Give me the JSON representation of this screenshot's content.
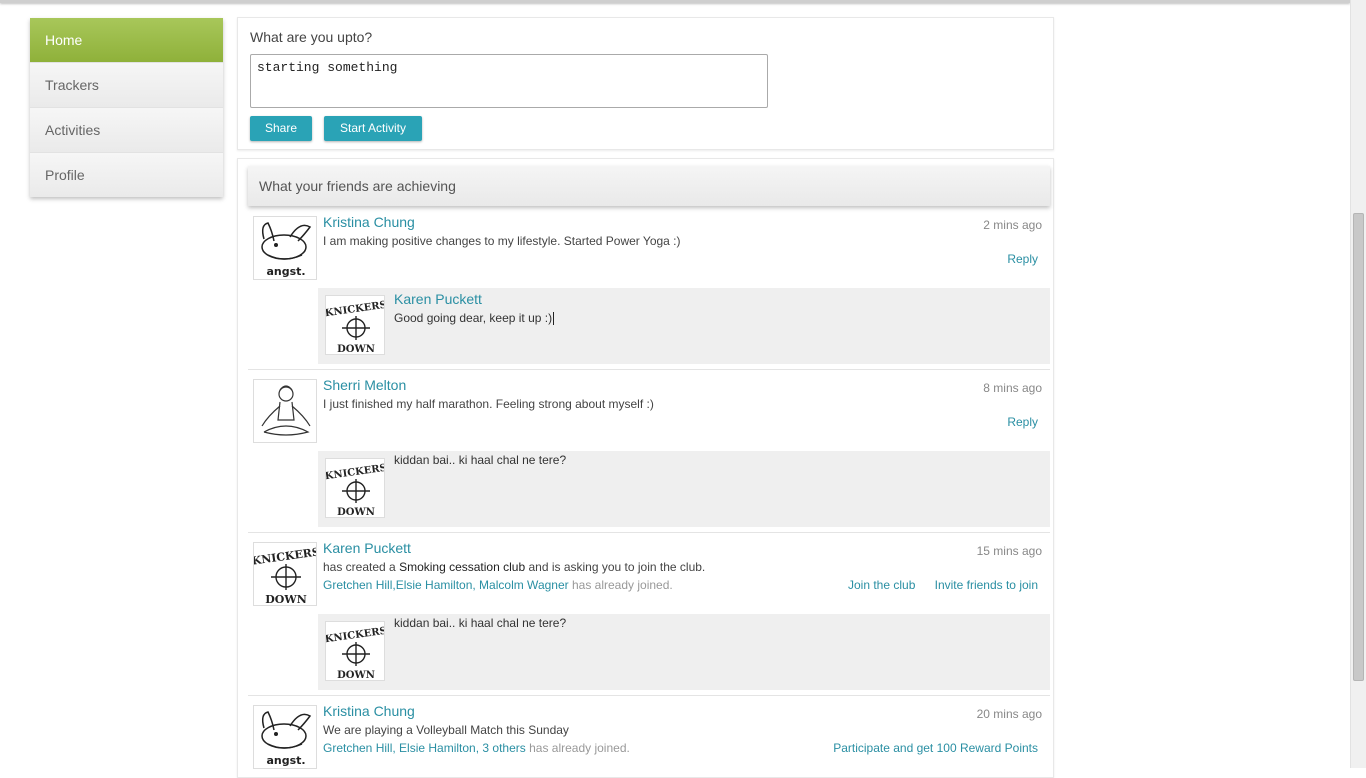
{
  "sidebar": {
    "items": [
      {
        "label": "Home",
        "active": true
      },
      {
        "label": "Trackers",
        "active": false
      },
      {
        "label": "Activities",
        "active": false
      },
      {
        "label": "Profile",
        "active": false
      }
    ]
  },
  "status": {
    "question": "What are you upto?",
    "input_value": "starting something",
    "share_label": "Share",
    "start_activity_label": "Start Activity"
  },
  "feed": {
    "header": "What your friends are achieving",
    "posts": [
      {
        "author": "Kristina Chung",
        "time": "2 mins ago",
        "text": "I am making positive changes to my lifestyle. Started Power Yoga :)",
        "action": "Reply",
        "reply": {
          "author": "Karen Puckett",
          "text": "Good going dear, keep it up :)"
        }
      },
      {
        "author": "Sherri Melton",
        "time": "8 mins ago",
        "text": "I just finished my half marathon. Feeling strong about myself :)",
        "action": "Reply",
        "reply": {
          "author": "",
          "text": "kiddan bai.. ki haal chal ne tere?"
        }
      },
      {
        "author": "Karen Puckett",
        "time": "15 mins ago",
        "text_prefix": "has created a",
        "club_name": "Smoking cessation club",
        "text_suffix": "and is asking you to join the club.",
        "joined_names": "Gretchen Hill,Elsie Hamilton, Malcolm Wagner",
        "joined_suffix": "has already joined.",
        "action_join": "Join the club",
        "action_invite": "Invite friends to join",
        "reply": {
          "author": "",
          "text": "kiddan bai.. ki haal chal ne tere?"
        }
      },
      {
        "author": "Kristina Chung",
        "time": "20 mins ago",
        "text": "We are playing a Volleyball Match this Sunday",
        "joined_names": "Gretchen Hill, Elsie Hamilton, 3 others",
        "joined_suffix": "has already joined.",
        "action": "Participate and get 100 Reward Points"
      }
    ]
  },
  "avatars": {
    "bunny_caption": "angst.",
    "knickers_top": "KNICKERS",
    "knickers_bottom": "DOWN"
  },
  "colors": {
    "accent": "#2aa3b6",
    "nav_active": "#9bbb47",
    "link": "#2a8fa3"
  }
}
